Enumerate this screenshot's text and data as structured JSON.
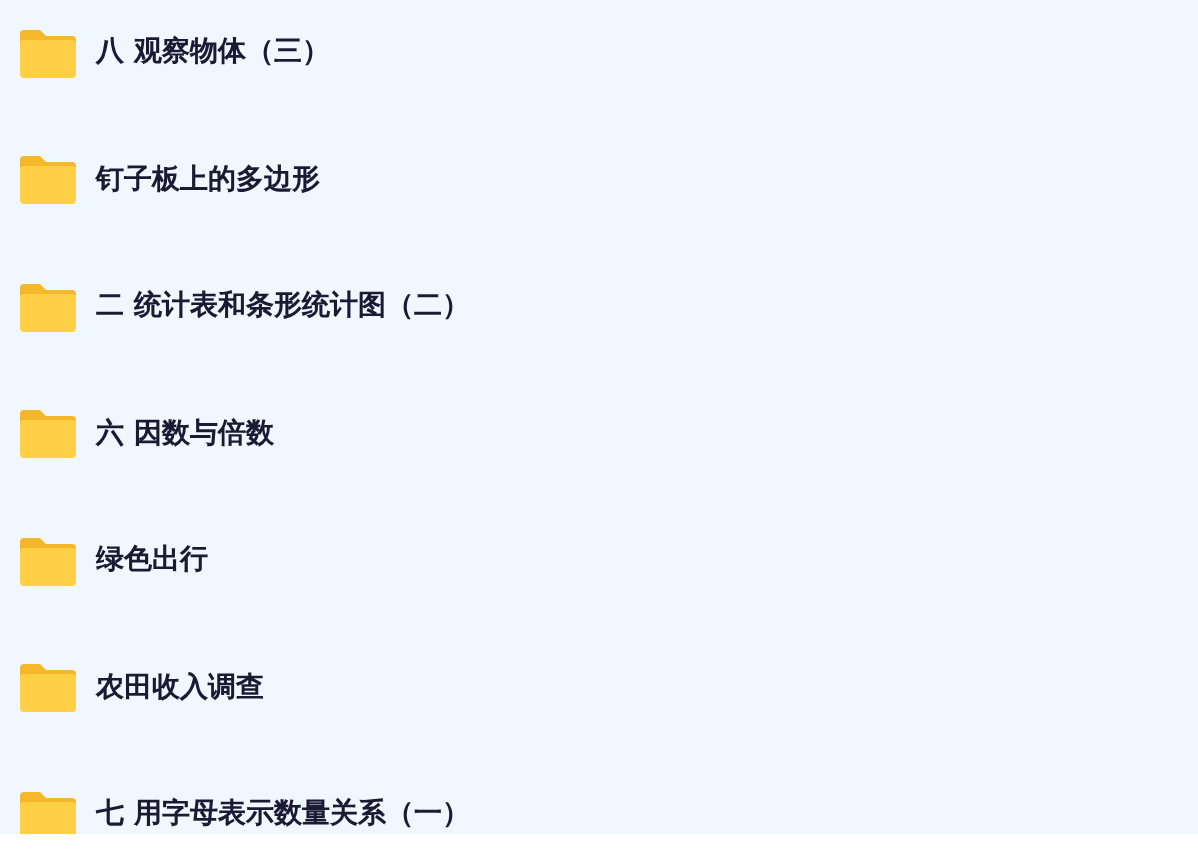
{
  "folders": [
    {
      "name": "八 观察物体（三）"
    },
    {
      "name": "钉子板上的多边形"
    },
    {
      "name": "二 统计表和条形统计图（二）"
    },
    {
      "name": "六 因数与倍数"
    },
    {
      "name": "绿色出行"
    },
    {
      "name": "农田收入调查"
    },
    {
      "name": "七 用字母表示数量关系（一）"
    }
  ]
}
